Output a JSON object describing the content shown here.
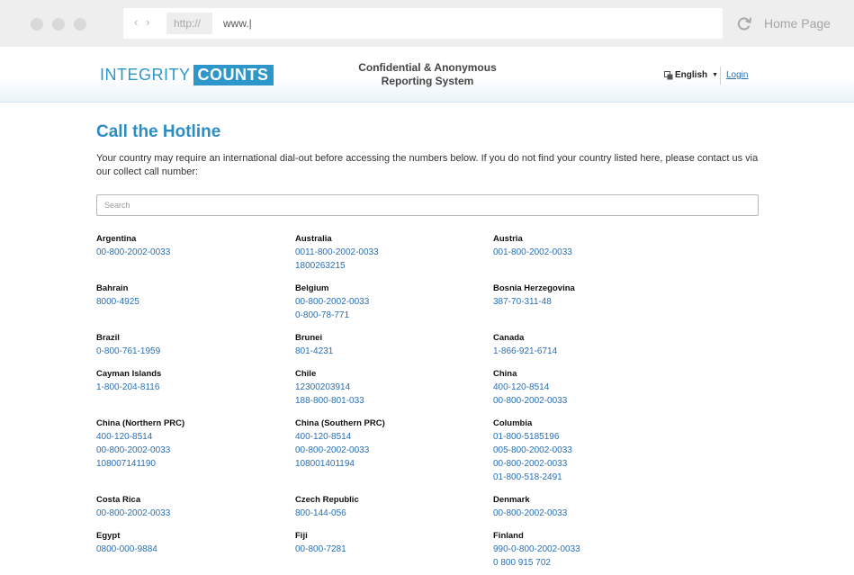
{
  "browser": {
    "protocol": "http://",
    "url": "www.|",
    "home_label": "Home Page",
    "back_icon": "‹",
    "forward_icon": "›"
  },
  "header": {
    "logo_part1": "INTEGRITY",
    "logo_part2": "COUNTS",
    "title_line1": "Confidential & Anonymous",
    "title_line2": "Reporting System",
    "language": "English",
    "login": "Login"
  },
  "page": {
    "title": "Call the Hotline",
    "intro": "Your country may require an international dial-out before accessing the numbers below. If you do not find your country listed here, please contact us via our collect call number:",
    "search_placeholder": "Search"
  },
  "countries": [
    {
      "name": "Argentina",
      "numbers": [
        "00-800-2002-0033"
      ]
    },
    {
      "name": "Australia",
      "numbers": [
        "0011-800-2002-0033",
        "1800263215"
      ]
    },
    {
      "name": "Austria",
      "numbers": [
        "001-800-2002-0033"
      ]
    },
    {
      "name": "Bahrain",
      "numbers": [
        "8000-4925"
      ]
    },
    {
      "name": "Belgium",
      "numbers": [
        "00-800-2002-0033",
        "0-800-78-771"
      ]
    },
    {
      "name": "Bosnia Herzegovina",
      "numbers": [
        "387-70-311-48"
      ]
    },
    {
      "name": "Brazil",
      "numbers": [
        "0-800-761-1959"
      ]
    },
    {
      "name": "Brunei",
      "numbers": [
        "801-4231"
      ]
    },
    {
      "name": "Canada",
      "numbers": [
        "1-866-921-6714"
      ]
    },
    {
      "name": "Cayman Islands",
      "numbers": [
        "1-800-204-8116"
      ]
    },
    {
      "name": "Chile",
      "numbers": [
        "12300203914",
        "188-800-801-033"
      ]
    },
    {
      "name": "China",
      "numbers": [
        "400-120-8514",
        "00-800-2002-0033"
      ]
    },
    {
      "name": "China (Northern PRC)",
      "numbers": [
        "400-120-8514",
        "00-800-2002-0033",
        "108007141190"
      ]
    },
    {
      "name": "China (Southern PRC)",
      "numbers": [
        "400-120-8514",
        "00-800-2002-0033",
        "108001401194"
      ]
    },
    {
      "name": "Columbia",
      "numbers": [
        "01-800-5185196",
        "005-800-2002-0033",
        "00-800-2002-0033",
        "01-800-518-2491"
      ]
    },
    {
      "name": "Costa Rica",
      "numbers": [
        "00-800-2002-0033"
      ]
    },
    {
      "name": "Czech Republic",
      "numbers": [
        "800-144-056"
      ]
    },
    {
      "name": "Denmark",
      "numbers": [
        "00-800-2002-0033"
      ]
    },
    {
      "name": "Egypt",
      "numbers": [
        "0800-000-9884"
      ]
    },
    {
      "name": "Fiji",
      "numbers": [
        "00-800-7281"
      ]
    },
    {
      "name": "Finland",
      "numbers": [
        "990-0-800-2002-0033",
        "0 800 915 702"
      ]
    }
  ]
}
